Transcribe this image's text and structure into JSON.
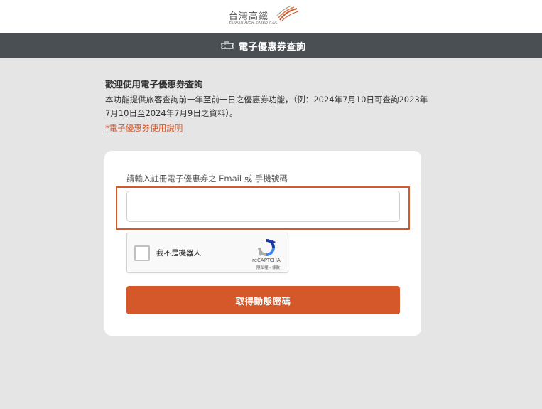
{
  "header": {
    "logo_cn": "台灣高鐵",
    "logo_en": "TAIWAN HIGH SPEED RAIL"
  },
  "titlebar": {
    "title": "電子優惠券查詢"
  },
  "intro": {
    "heading": "歡迎使用電子優惠券查詢",
    "description": "本功能提供旅客查詢前一年至前一日之優惠券功能，（例：2024年7月10日可查詢2023年7月10日至2024年7月9日之資料）。",
    "link": "*電子優惠券使用說明"
  },
  "form": {
    "field_label": "請輸入註冊電子優惠券之 Email 或 手機號碼",
    "field_value": "",
    "field_placeholder": "",
    "submit_label": "取得動態密碼"
  },
  "recaptcha": {
    "label": "我不是機器人",
    "brand": "reCAPTCHA",
    "links": "隱私權 - 條款"
  },
  "colors": {
    "accent": "#d4582a",
    "titlebar": "#4a4f54",
    "background": "#e5e5e5"
  }
}
